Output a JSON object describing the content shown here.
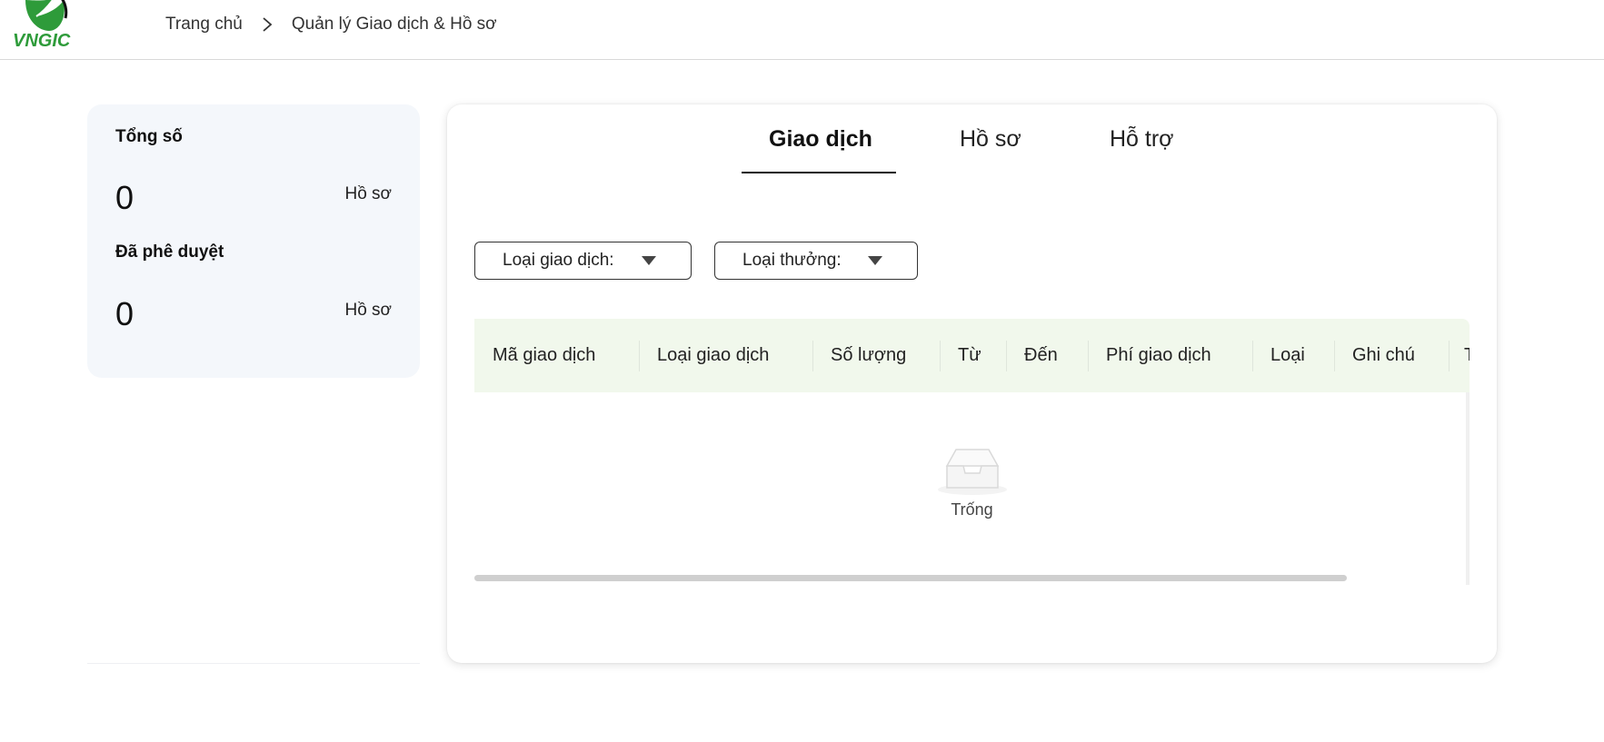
{
  "header": {
    "logo_text": "VNGIC",
    "breadcrumb": {
      "home": "Trang chủ",
      "current": "Quản lý Giao dịch & Hồ sơ"
    }
  },
  "summary": {
    "total_label": "Tổng số",
    "total_value": "0",
    "total_unit": "Hồ sơ",
    "approved_label": "Đã phê duyệt",
    "approved_value": "0",
    "approved_unit": "Hồ sơ"
  },
  "tabs": [
    {
      "label": "Giao dịch",
      "active": true
    },
    {
      "label": "Hồ sơ",
      "active": false
    },
    {
      "label": "Hỗ trợ",
      "active": false
    }
  ],
  "filters": {
    "transaction_type": "Loại giao dịch:",
    "reward_type": "Loại thưởng:"
  },
  "table": {
    "columns": [
      "Mã giao dịch",
      "Loại giao dịch",
      "Số lượng",
      "Từ",
      "Đến",
      "Phí giao dịch",
      "Loại",
      "Ghi chú",
      "T"
    ],
    "rows": [],
    "empty_text": "Trống"
  },
  "colors": {
    "brand_green": "#2e9b3a",
    "table_header_bg": "#f1f8ec",
    "summary_bg": "#f4f7fb"
  }
}
